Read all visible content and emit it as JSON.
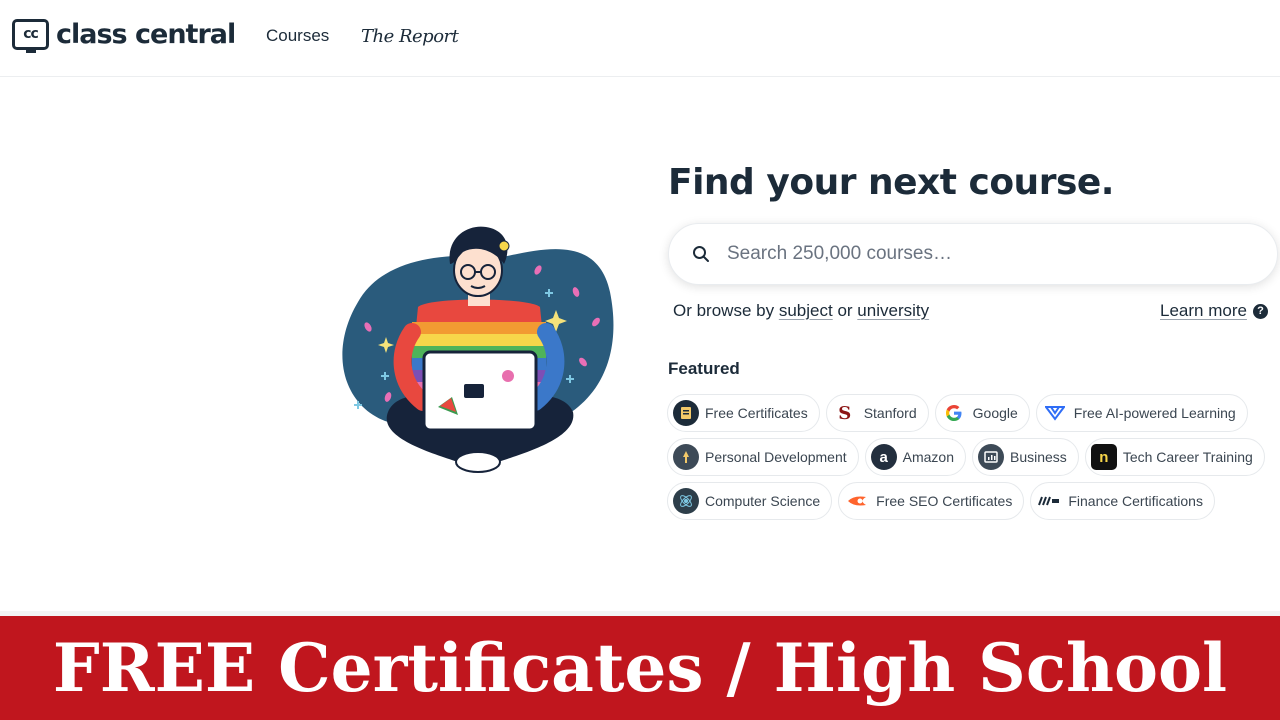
{
  "header": {
    "logo_mark": "cc",
    "logo_text": "class central",
    "nav": {
      "courses": "Courses",
      "report": "The Report"
    }
  },
  "hero": {
    "title": "Find your next course.",
    "search_placeholder": "Search 250,000 courses…",
    "browse_prefix": "Or browse by",
    "browse_subject": "subject",
    "browse_or": "or",
    "browse_university": "university",
    "learn_more": "Learn more",
    "help_glyph": "?"
  },
  "featured": {
    "label": "Featured",
    "rows": [
      [
        {
          "label": "Free Certificates",
          "icon": "certificate-icon",
          "color": "#1c2b39"
        },
        {
          "label": "Stanford",
          "icon": "stanford-icon",
          "color": "#8c1515"
        },
        {
          "label": "Google",
          "icon": "google-icon",
          "color": "#4285f4"
        },
        {
          "label": "Free AI-powered Learning",
          "icon": "ai-learning-icon",
          "color": "#2f6df6"
        }
      ],
      [
        {
          "label": "Personal Development",
          "icon": "personal-development-icon",
          "color": "#3d4a57"
        },
        {
          "label": "Amazon",
          "icon": "amazon-icon",
          "color": "#232f3e"
        },
        {
          "label": "Business",
          "icon": "business-icon",
          "color": "#3d4a57"
        },
        {
          "label": "Tech Career Training",
          "icon": "tech-career-icon",
          "color": "#111111"
        }
      ],
      [
        {
          "label": "Computer Science",
          "icon": "computer-science-icon",
          "color": "#2d3e4a"
        },
        {
          "label": "Free SEO Certificates",
          "icon": "seo-icon",
          "color": "#ff642d"
        },
        {
          "label": "Finance Certifications",
          "icon": "finance-icon",
          "color": "#1c2b39"
        }
      ]
    ]
  },
  "banner": {
    "text": "FREE Certificates / High School"
  },
  "colors": {
    "primary": "#1c2b39",
    "banner": "#c0161e",
    "blob": "#2a5b7c"
  }
}
